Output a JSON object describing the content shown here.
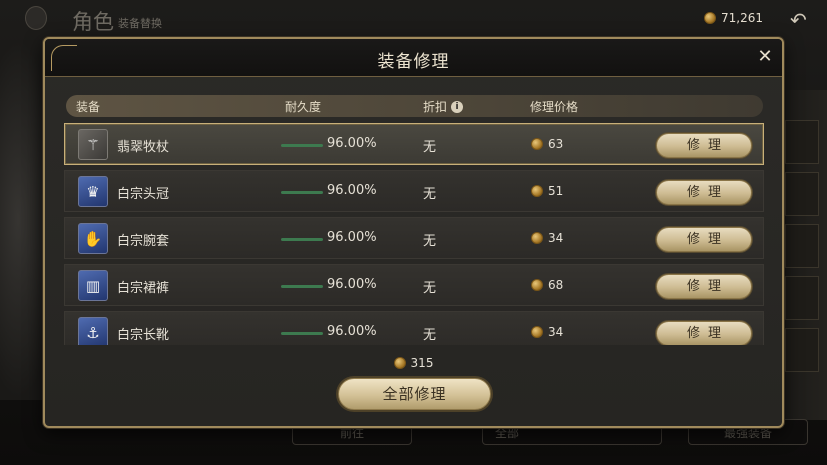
{
  "topbar": {
    "title": "角色",
    "subtitle": "装备替换",
    "gold": "71,261",
    "back_icon": "back-arrow-icon"
  },
  "bottom_bg": {
    "btn1": "前往",
    "btn2": "全部",
    "btn3": "最强装备"
  },
  "modal": {
    "title": "装备修理",
    "close_icon": "close-icon",
    "columns": {
      "equipment": "装备",
      "durability": "耐久度",
      "discount": "折扣",
      "price": "修理价格"
    },
    "rows": [
      {
        "name": "翡翠牧杖",
        "icon": "staff-icon",
        "durability": "96.00%",
        "discount": "无",
        "price": "63",
        "button": "修理",
        "selected": true
      },
      {
        "name": "白宗头冠",
        "icon": "crown-icon",
        "durability": "96.00%",
        "discount": "无",
        "price": "51",
        "button": "修理",
        "selected": false
      },
      {
        "name": "白宗腕套",
        "icon": "bracer-icon",
        "durability": "96.00%",
        "discount": "无",
        "price": "34",
        "button": "修理",
        "selected": false
      },
      {
        "name": "白宗裙裤",
        "icon": "pants-icon",
        "durability": "96.00%",
        "discount": "无",
        "price": "68",
        "button": "修理",
        "selected": false
      },
      {
        "name": "白宗长靴",
        "icon": "boots-icon",
        "durability": "96.00%",
        "discount": "无",
        "price": "34",
        "button": "修理",
        "selected": false
      }
    ],
    "total": "315",
    "repair_all": "全部修理"
  },
  "colors": {
    "accent_gold": "#a08a5c",
    "durability_green": "#3d7a4f",
    "button_cream": "#d3c196"
  }
}
